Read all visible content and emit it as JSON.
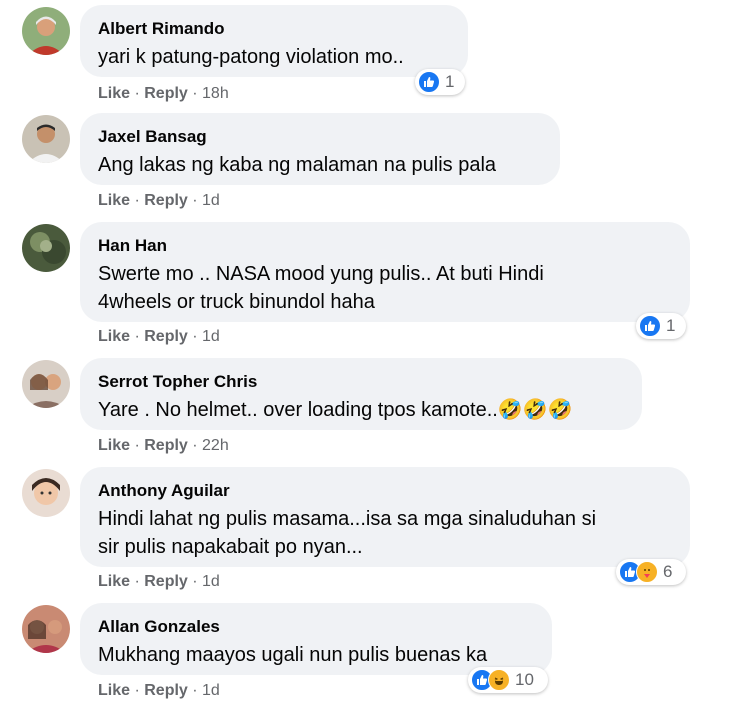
{
  "actions": {
    "like": "Like",
    "reply": "Reply",
    "sep": " · "
  },
  "comments": [
    {
      "name": "Albert Rimando",
      "lines": [
        "yari k patung-patong violation mo.."
      ],
      "time": "18h",
      "reaction_count": "1",
      "reactions": [
        "like"
      ]
    },
    {
      "name": "Jaxel Bansag",
      "lines": [
        "Ang lakas ng kaba ng malaman na pulis pala"
      ],
      "time": "1d"
    },
    {
      "name": "Han Han",
      "lines": [
        "Swerte mo .. NASA mood yung pulis.. At buti Hindi",
        "4wheels or truck binundol haha"
      ],
      "time": "1d",
      "reaction_count": "1",
      "reactions": [
        "like"
      ]
    },
    {
      "name": "Serrot Topher Chris",
      "lines": [
        "Yare . No helmet.. over loading tpos kamote..🤣🤣🤣"
      ],
      "time": "22h"
    },
    {
      "name": "Anthony Aguilar",
      "lines": [
        "Hindi lahat ng pulis masama...isa sa mga sinaluduhan si",
        "sir pulis napakabait po nyan..."
      ],
      "time": "1d",
      "reaction_count": "6",
      "reactions": [
        "like",
        "care"
      ]
    },
    {
      "name": "Allan Gonzales",
      "lines": [
        "Mukhang maayos ugali nun pulis buenas ka"
      ],
      "time": "1d",
      "reaction_count": "10",
      "reactions": [
        "like",
        "haha"
      ]
    }
  ],
  "colors": {
    "like": "#1877f2",
    "haha": "#f7b125",
    "care": "#f7b125",
    "muted": "#65676b",
    "bubble": "#f0f2f5"
  }
}
